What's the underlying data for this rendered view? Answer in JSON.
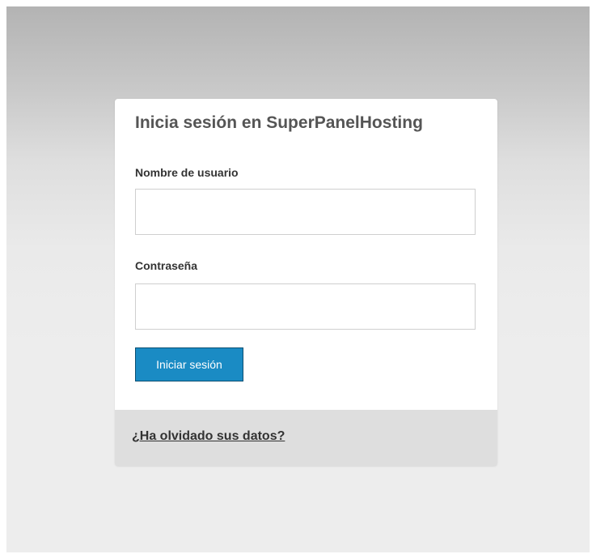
{
  "login": {
    "title": "Inicia sesión en SuperPanelHosting",
    "username_label": "Nombre de usuario",
    "username_value": "",
    "password_label": "Contraseña",
    "password_value": "",
    "submit_label": "Iniciar sesión",
    "forgot_link": "¿Ha olvidado sus datos?"
  },
  "colors": {
    "button_bg": "#1a8bc4",
    "button_border": "#0b4f72",
    "footer_bg": "#dedede",
    "title_text": "#555555"
  }
}
